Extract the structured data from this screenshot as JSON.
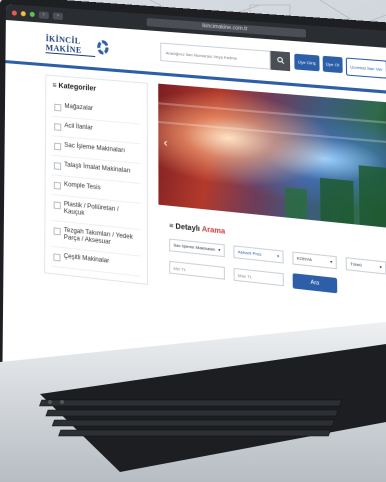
{
  "browser": {
    "url": "ikincimakine.com.tr",
    "back_label": "‹",
    "forward_label": "›"
  },
  "header": {
    "logo_text": "İKİNCİL MAKİNE",
    "search_placeholder": "Aradığınız İlan Numarası Veya Kelime",
    "search_icon": "search-icon",
    "login_label": "Üye Giriş",
    "register_label": "Üye Ol",
    "post_ad_label": "Ücretsiz İlan Ver"
  },
  "sidebar": {
    "title": "Kategoriler",
    "items": [
      {
        "label": "Mağazalar"
      },
      {
        "label": "Acil İlanlar"
      },
      {
        "label": "Sac İşleme Makinaları"
      },
      {
        "label": "Talaşlı İmalat Makinaları"
      },
      {
        "label": "Komple Tesis"
      },
      {
        "label": "Plastik / Poliüretan / Kauçuk"
      },
      {
        "label": "Tezgah Takımları / Yedek Parça / Aksesuar"
      },
      {
        "label": "Çeşitli Makinalar"
      }
    ]
  },
  "detail_search": {
    "title_prefix": "Detaylı",
    "title_highlight": "Arama",
    "category_value": "Sac İşleme Makinaları",
    "subcategory_value": "Abkant Pres",
    "city_value": "KONYA",
    "district_value": "Tümü",
    "min_placeholder": "Min TL",
    "max_placeholder": "Max TL",
    "search_button": "Ara"
  },
  "colors": {
    "brand_blue": "#2d5fa8",
    "highlight_red": "#d23b3b"
  }
}
